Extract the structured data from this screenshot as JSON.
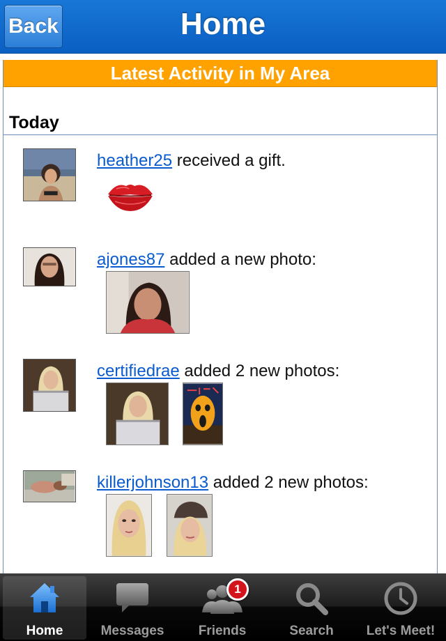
{
  "nav": {
    "back_label": "Back",
    "title": "Home"
  },
  "banner": "Latest Activity in My Area",
  "section": "Today",
  "feed": [
    {
      "user": "heather25",
      "action": "received a gift."
    },
    {
      "user": "ajones87",
      "action": "added a new photo:"
    },
    {
      "user": "certifiedrae",
      "action": "added 2 new photos:"
    },
    {
      "user": "killerjohnson13",
      "action": "added 2 new photos:"
    }
  ],
  "tabs": [
    {
      "label": "Home",
      "icon": "house-icon",
      "active": true
    },
    {
      "label": "Messages",
      "icon": "speech-bubble-icon"
    },
    {
      "label": "Friends",
      "icon": "people-icon",
      "badge": "1"
    },
    {
      "label": "Search",
      "icon": "magnifier-icon"
    },
    {
      "label": "Let's Meet!",
      "icon": "clock-icon"
    }
  ],
  "colors": {
    "nav_blue": "#0a5fc2",
    "banner_orange": "#ffa200",
    "link_blue": "#0a5bd0",
    "badge_red": "#d4141c"
  }
}
